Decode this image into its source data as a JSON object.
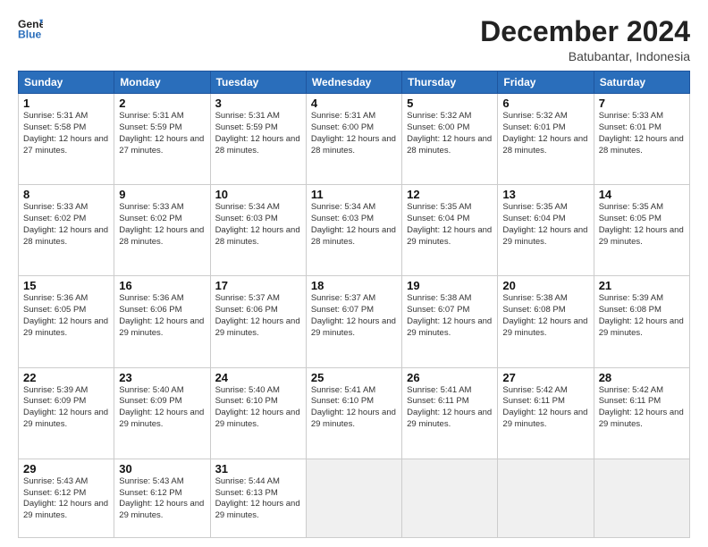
{
  "header": {
    "logo_line1": "General",
    "logo_line2": "Blue",
    "title": "December 2024",
    "subtitle": "Batubantar, Indonesia"
  },
  "days_of_week": [
    "Sunday",
    "Monday",
    "Tuesday",
    "Wednesday",
    "Thursday",
    "Friday",
    "Saturday"
  ],
  "weeks": [
    [
      {
        "day": 1,
        "rise": "5:31 AM",
        "set": "5:58 PM",
        "daylight": "12 hours and 27 minutes."
      },
      {
        "day": 2,
        "rise": "5:31 AM",
        "set": "5:59 PM",
        "daylight": "12 hours and 27 minutes."
      },
      {
        "day": 3,
        "rise": "5:31 AM",
        "set": "5:59 PM",
        "daylight": "12 hours and 28 minutes."
      },
      {
        "day": 4,
        "rise": "5:31 AM",
        "set": "6:00 PM",
        "daylight": "12 hours and 28 minutes."
      },
      {
        "day": 5,
        "rise": "5:32 AM",
        "set": "6:00 PM",
        "daylight": "12 hours and 28 minutes."
      },
      {
        "day": 6,
        "rise": "5:32 AM",
        "set": "6:01 PM",
        "daylight": "12 hours and 28 minutes."
      },
      {
        "day": 7,
        "rise": "5:33 AM",
        "set": "6:01 PM",
        "daylight": "12 hours and 28 minutes."
      }
    ],
    [
      {
        "day": 8,
        "rise": "5:33 AM",
        "set": "6:02 PM",
        "daylight": "12 hours and 28 minutes."
      },
      {
        "day": 9,
        "rise": "5:33 AM",
        "set": "6:02 PM",
        "daylight": "12 hours and 28 minutes."
      },
      {
        "day": 10,
        "rise": "5:34 AM",
        "set": "6:03 PM",
        "daylight": "12 hours and 28 minutes."
      },
      {
        "day": 11,
        "rise": "5:34 AM",
        "set": "6:03 PM",
        "daylight": "12 hours and 28 minutes."
      },
      {
        "day": 12,
        "rise": "5:35 AM",
        "set": "6:04 PM",
        "daylight": "12 hours and 29 minutes."
      },
      {
        "day": 13,
        "rise": "5:35 AM",
        "set": "6:04 PM",
        "daylight": "12 hours and 29 minutes."
      },
      {
        "day": 14,
        "rise": "5:35 AM",
        "set": "6:05 PM",
        "daylight": "12 hours and 29 minutes."
      }
    ],
    [
      {
        "day": 15,
        "rise": "5:36 AM",
        "set": "6:05 PM",
        "daylight": "12 hours and 29 minutes."
      },
      {
        "day": 16,
        "rise": "5:36 AM",
        "set": "6:06 PM",
        "daylight": "12 hours and 29 minutes."
      },
      {
        "day": 17,
        "rise": "5:37 AM",
        "set": "6:06 PM",
        "daylight": "12 hours and 29 minutes."
      },
      {
        "day": 18,
        "rise": "5:37 AM",
        "set": "6:07 PM",
        "daylight": "12 hours and 29 minutes."
      },
      {
        "day": 19,
        "rise": "5:38 AM",
        "set": "6:07 PM",
        "daylight": "12 hours and 29 minutes."
      },
      {
        "day": 20,
        "rise": "5:38 AM",
        "set": "6:08 PM",
        "daylight": "12 hours and 29 minutes."
      },
      {
        "day": 21,
        "rise": "5:39 AM",
        "set": "6:08 PM",
        "daylight": "12 hours and 29 minutes."
      }
    ],
    [
      {
        "day": 22,
        "rise": "5:39 AM",
        "set": "6:09 PM",
        "daylight": "12 hours and 29 minutes."
      },
      {
        "day": 23,
        "rise": "5:40 AM",
        "set": "6:09 PM",
        "daylight": "12 hours and 29 minutes."
      },
      {
        "day": 24,
        "rise": "5:40 AM",
        "set": "6:10 PM",
        "daylight": "12 hours and 29 minutes."
      },
      {
        "day": 25,
        "rise": "5:41 AM",
        "set": "6:10 PM",
        "daylight": "12 hours and 29 minutes."
      },
      {
        "day": 26,
        "rise": "5:41 AM",
        "set": "6:11 PM",
        "daylight": "12 hours and 29 minutes."
      },
      {
        "day": 27,
        "rise": "5:42 AM",
        "set": "6:11 PM",
        "daylight": "12 hours and 29 minutes."
      },
      {
        "day": 28,
        "rise": "5:42 AM",
        "set": "6:11 PM",
        "daylight": "12 hours and 29 minutes."
      }
    ],
    [
      {
        "day": 29,
        "rise": "5:43 AM",
        "set": "6:12 PM",
        "daylight": "12 hours and 29 minutes."
      },
      {
        "day": 30,
        "rise": "5:43 AM",
        "set": "6:12 PM",
        "daylight": "12 hours and 29 minutes."
      },
      {
        "day": 31,
        "rise": "5:44 AM",
        "set": "6:13 PM",
        "daylight": "12 hours and 29 minutes."
      },
      null,
      null,
      null,
      null
    ]
  ]
}
